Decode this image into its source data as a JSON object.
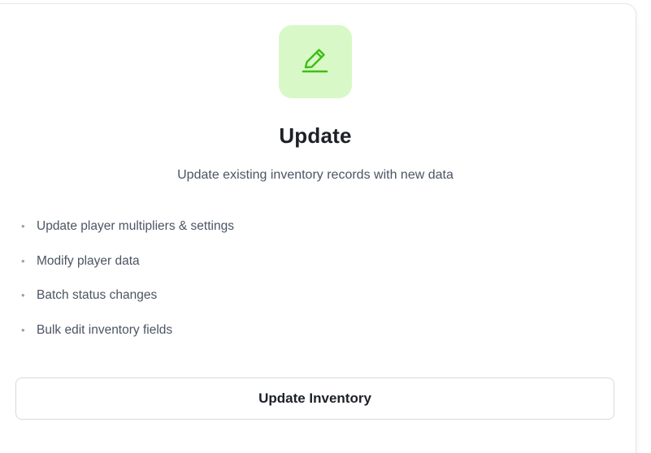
{
  "card": {
    "icon": "pencil-edit-icon",
    "icon_color": "#3cbf13",
    "icon_tile_color": "#d9f8c7",
    "title": "Update",
    "subtitle": "Update existing inventory records with new data",
    "features": [
      "Update player multipliers & settings",
      "Modify player data",
      "Batch status changes",
      "Bulk edit inventory fields"
    ],
    "action_label": "Update Inventory"
  }
}
